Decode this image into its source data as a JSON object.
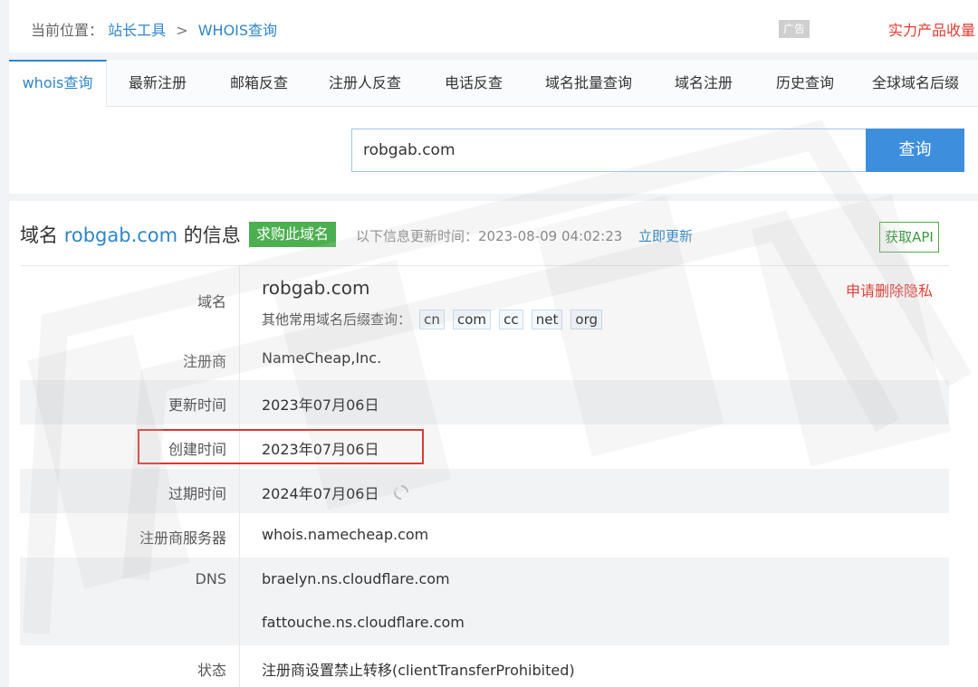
{
  "breadcrumb": {
    "prefix": "当前位置：",
    "item1": "站长工具",
    "separator": ">",
    "item2": "WHOIS查询"
  },
  "ad": {
    "tag": "广告",
    "text": "实力产品收量"
  },
  "tabs": [
    {
      "label": "whois查询",
      "active": true
    },
    {
      "label": "最新注册"
    },
    {
      "label": "邮箱反查"
    },
    {
      "label": "注册人反查"
    },
    {
      "label": "电话反查"
    },
    {
      "label": "域名批量查询"
    },
    {
      "label": "域名注册"
    },
    {
      "label": "历史查询"
    },
    {
      "label": "全球域名后缀"
    }
  ],
  "search": {
    "value": "robgab.com",
    "button": "查询"
  },
  "info": {
    "title_prefix": "域名 ",
    "title_domain": "robgab.com",
    "title_suffix": " 的信息",
    "buy_badge": "求购此域名",
    "update_text": "以下信息更新时间：2023-08-09 04:02:23",
    "update_link": "立即更新",
    "api_button": "获取API"
  },
  "rows": {
    "domain_label": "域名",
    "domain_value": "robgab.com",
    "privacy_link": "申请删除隐私",
    "suffix_label": "其他常用域名后缀查询：",
    "suffixes": [
      "cn",
      "com",
      "cc",
      "net",
      "org"
    ],
    "registrar_label": "注册商",
    "registrar_value": "NameCheap,Inc.",
    "updated_label": "更新时间",
    "updated_value": "2023年07月06日",
    "created_label": "创建时间",
    "created_value": "2023年07月06日",
    "expire_label": "过期时间",
    "expire_value": "2024年07月06日",
    "server_label": "注册商服务器",
    "server_value": "whois.namecheap.com",
    "dns_label": "DNS",
    "dns_values": [
      "braelyn.ns.cloudflare.com",
      "fattouche.ns.cloudflare.com"
    ],
    "status_label": "状态",
    "status_value": "注册商设置禁止转移(clientTransferProhibited)"
  },
  "colors": {
    "accent": "#2e86c9",
    "button": "#3d8fde",
    "green": "#4caf50",
    "red": "#e23a2f"
  }
}
